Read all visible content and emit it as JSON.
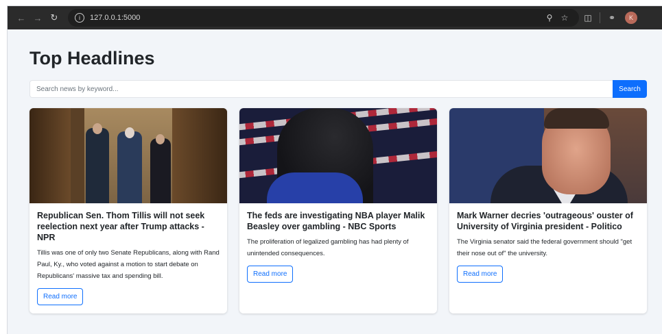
{
  "browser": {
    "url": "127.0.0.1:5000",
    "avatar_initial": "K"
  },
  "page": {
    "title": "Top Headlines",
    "search": {
      "placeholder": "Search news by keyword...",
      "button_label": "Search"
    }
  },
  "articles": [
    {
      "title": "Republican Sen. Thom Tillis will not seek reelection next year after Trump attacks - NPR",
      "description": "Tillis was one of only two Senate Republicans, along with Rand Paul, Ky., who voted against a motion to start debate on Republicans' massive tax and spending bill.",
      "button_label": "Read more"
    },
    {
      "title": "The feds are investigating NBA player Malik Beasley over gambling - NBC Sports",
      "description": "The proliferation of legalized gambling has had plenty of unintended consequences.",
      "button_label": "Read more"
    },
    {
      "title": "Mark Warner decries 'outrageous' ouster of University of Virginia president - Politico",
      "description": "The Virginia senator said the federal government should \"get their nose out of\" the university.",
      "button_label": "Read more"
    }
  ],
  "colors": {
    "primary": "#0d6efd",
    "page_bg": "#f2f5f9",
    "chrome_bg": "#2b2b2b"
  }
}
